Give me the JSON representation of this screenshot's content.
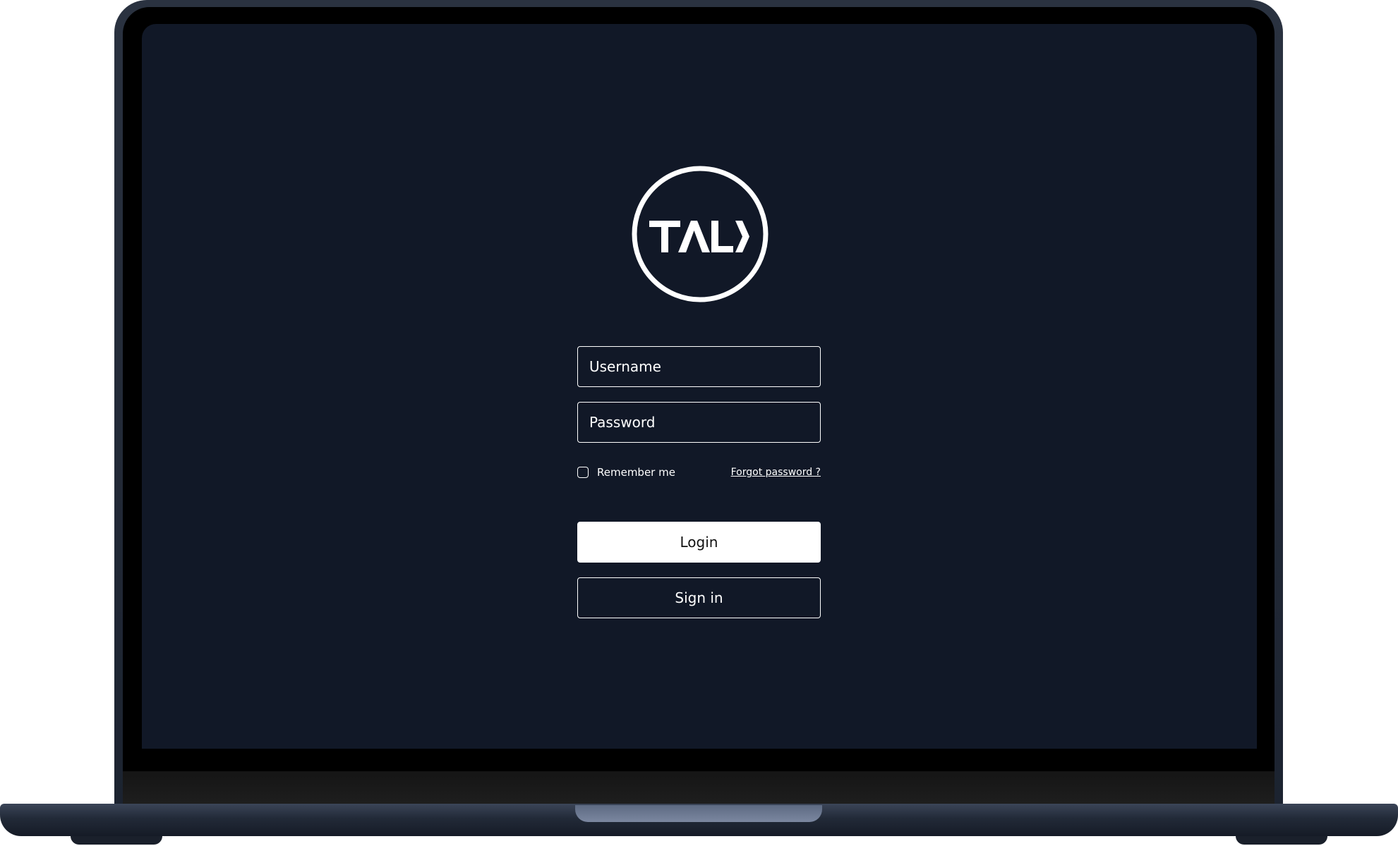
{
  "logo": {
    "text": "TALK",
    "icon": "talk-logo-circle"
  },
  "form": {
    "username": {
      "placeholder": "Username",
      "value": ""
    },
    "password": {
      "placeholder": "Password",
      "value": ""
    },
    "remember_me_label": "Remember me",
    "remember_me_checked": false,
    "forgot_password_label": "Forgot password ?",
    "login_label": "Login",
    "signin_label": "Sign in"
  },
  "colors": {
    "screen_background": "#111827",
    "foreground": "#ffffff",
    "primary_button": "#ffffff",
    "primary_button_text": "#111111"
  }
}
